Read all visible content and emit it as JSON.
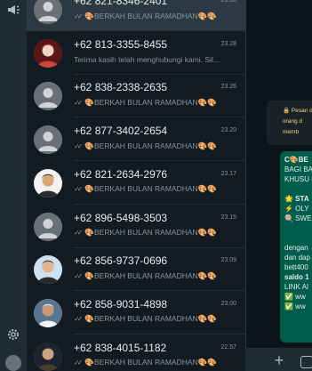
{
  "chats": [
    {
      "name": "+62 821-8346-2401",
      "time": "23.30",
      "ticks": "✓✓",
      "snippet": "🎨BERKAH BULAN RAMADHAN🎨🎨",
      "avatar": "default",
      "selected": true
    },
    {
      "name": "+62 813-3355-8455",
      "time": "23.28",
      "ticks": "",
      "snippet": "Terima kasih telah menghubungi kami. Sil...",
      "avatar": "photo-red",
      "selected": false
    },
    {
      "name": "+62 838-2338-2635",
      "time": "23.26",
      "ticks": "✓✓",
      "snippet": "🎨BERKAH BULAN RAMADHAN🎨🎨",
      "avatar": "default",
      "selected": false
    },
    {
      "name": "+62 877-3402-2654",
      "time": "23.20",
      "ticks": "✓✓",
      "snippet": "🎨BERKAH BULAN RAMADHAN🎨🎨",
      "avatar": "default",
      "selected": false
    },
    {
      "name": "+62 821-2634-2976",
      "time": "23.17",
      "ticks": "✓✓",
      "snippet": "🎨BERKAH BULAN RAMADHAN🎨🎨",
      "avatar": "photo-light",
      "selected": false
    },
    {
      "name": "+62 896-5498-3503",
      "time": "23.15",
      "ticks": "✓✓",
      "snippet": "🎨BERKAH BULAN RAMADHAN🎨🎨",
      "avatar": "default",
      "selected": false
    },
    {
      "name": "+62 856-9737-0696",
      "time": "23.09",
      "ticks": "✓✓",
      "snippet": "🎨BERKAH BULAN RAMADHAN🎨🎨",
      "avatar": "photo-person",
      "selected": false
    },
    {
      "name": "+62 858-9031-4898",
      "time": "23.00",
      "ticks": "✓✓",
      "snippet": "🎨BERKAH BULAN RAMADHAN🎨🎨",
      "avatar": "photo-cap",
      "selected": false
    },
    {
      "name": "+62 838-4015-1182",
      "time": "22.57",
      "ticks": "✓✓",
      "snippet": "🎨BERKAH BULAN RAMADHAN🎨🎨",
      "avatar": "photo-dark",
      "selected": false
    }
  ],
  "conversation": {
    "system_notice": [
      "🔒 Pesan d",
      "orang d",
      "memb"
    ],
    "bubble": [
      {
        "text": "C🎨BE",
        "bold": true
      },
      {
        "text": "BAGI BA",
        "bold": false
      },
      {
        "text": "KHUSU",
        "bold": false
      },
      {
        "text": "",
        "bold": false
      },
      {
        "text": "🌟 STA",
        "bold": true
      },
      {
        "text": "⚡ OLY",
        "bold": false
      },
      {
        "text": "🍭 SWE",
        "bold": false
      },
      {
        "text": "",
        "bold": false
      },
      {
        "text": "",
        "bold": false
      },
      {
        "text": "dengan",
        "bold": false
      },
      {
        "text": "dan dap",
        "bold": false
      },
      {
        "text": "bett400",
        "bold": false
      },
      {
        "text": "saldo 1",
        "bold": true
      },
      {
        "text": "LINK AI",
        "bold": false
      },
      {
        "text": "✅ ww",
        "bold": false
      },
      {
        "text": "✅ ww",
        "bold": false
      }
    ]
  },
  "icons": {
    "rail_top": "megaphone-icon",
    "rail_bottom": "settings-gear-icon",
    "compose_plus": "plus-icon",
    "compose_attach": "attach-icon"
  },
  "rail": {
    "plus_label": "+"
  },
  "colors": {
    "rail_bg": "#202c33",
    "list_bg": "#111b21",
    "selected_bg": "#2a3942",
    "conversation_bg": "#0b141a",
    "outgoing_bubble": "#005c4b",
    "notice_text": "#ffd279",
    "secondary_text": "#8696a0"
  }
}
